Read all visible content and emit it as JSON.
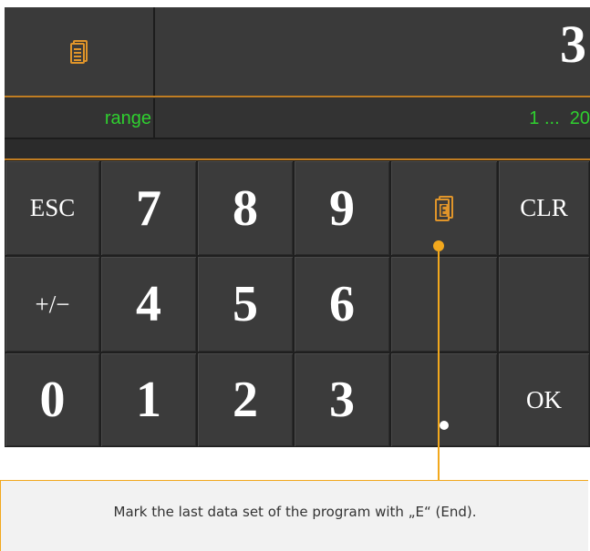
{
  "display": {
    "value": "3",
    "icon": "program-document-icon"
  },
  "range": {
    "label": "range",
    "value": "1 ...  20"
  },
  "keypad": {
    "esc_label": "ESC",
    "clr_label": "CLR",
    "ok_label": "OK",
    "sign_label": "+/−",
    "end_icon": "program-end-icon",
    "decimal_icon": "decimal-point-icon",
    "digits": {
      "d0": "0",
      "d1": "1",
      "d2": "2",
      "d3": "3",
      "d4": "4",
      "d5": "5",
      "d6": "6",
      "d7": "7",
      "d8": "8",
      "d9": "9"
    }
  },
  "callout": {
    "text": "Mark the last data set of the program with „E“ (End)."
  },
  "colors": {
    "panel": "#2e2e2e",
    "key": "#3b3b3b",
    "accent_orange": "#c07d22",
    "callout_orange": "#f2a81d",
    "range_green": "#2fd02f",
    "icon_orange": "#e0952a"
  }
}
